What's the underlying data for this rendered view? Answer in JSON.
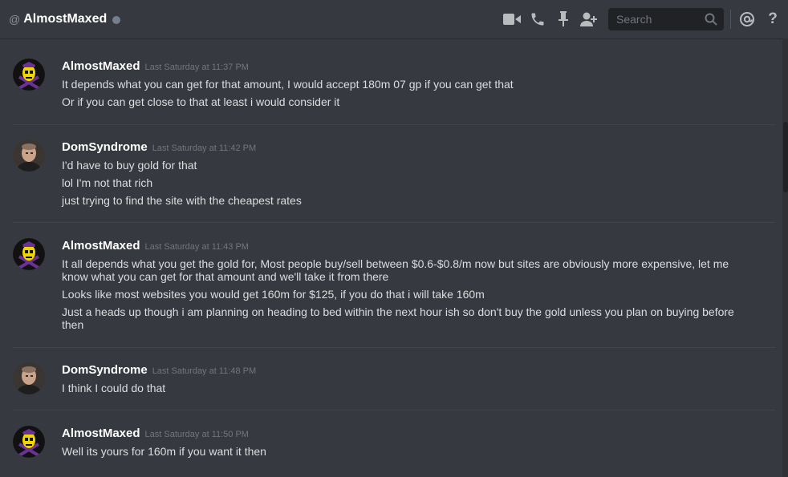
{
  "header": {
    "at_symbol": "@",
    "channel_name": "AlmostMaxed",
    "search_placeholder": "Search",
    "icons": [
      "video-call-icon",
      "voice-call-icon",
      "pin-icon",
      "add-friend-icon",
      "search-icon",
      "mention-icon",
      "help-icon"
    ],
    "help_glyph": "?"
  },
  "colors": {
    "background": "#36393f",
    "username": "#ffffff",
    "timestamp": "#72767d",
    "text": "#dcddde",
    "skeletor_purple": "#5b2c83",
    "skeletor_yellow": "#f0d600"
  },
  "messages": [
    {
      "author": "AlmostMaxed",
      "timestamp": "Last Saturday at 11:37 PM",
      "avatar": "skeletor-avatar",
      "lines": [
        "It depends what you can get for that amount, I would accept 180m 07 gp if you can get that",
        "Or if you can get close to that at least i would consider it"
      ]
    },
    {
      "author": "DomSyndrome",
      "timestamp": "Last Saturday at 11:42 PM",
      "avatar": "photo-avatar",
      "lines": [
        "I'd have to buy gold for that",
        "lol I'm not that rich",
        "just trying to find the site with the cheapest rates"
      ]
    },
    {
      "author": "AlmostMaxed",
      "timestamp": "Last Saturday at 11:43 PM",
      "avatar": "skeletor-avatar",
      "lines": [
        "It all depends what you get the gold for, Most people buy/sell between $0.6-$0.8/m now but sites are obviously more expensive, let me know what you can get for that amount and we'll take it from there",
        "Looks like most websites you would get 160m for $125, if you do that i will take 160m",
        "Just a heads up though i am planning on heading to bed within the next hour ish so don't buy the gold unless you plan on buying before then"
      ]
    },
    {
      "author": "DomSyndrome",
      "timestamp": "Last Saturday at 11:48 PM",
      "avatar": "photo-avatar",
      "lines": [
        "I think I could do that"
      ]
    },
    {
      "author": "AlmostMaxed",
      "timestamp": "Last Saturday at 11:50 PM",
      "avatar": "skeletor-avatar",
      "lines": [
        "Well its yours for 160m if you want it then"
      ]
    }
  ]
}
